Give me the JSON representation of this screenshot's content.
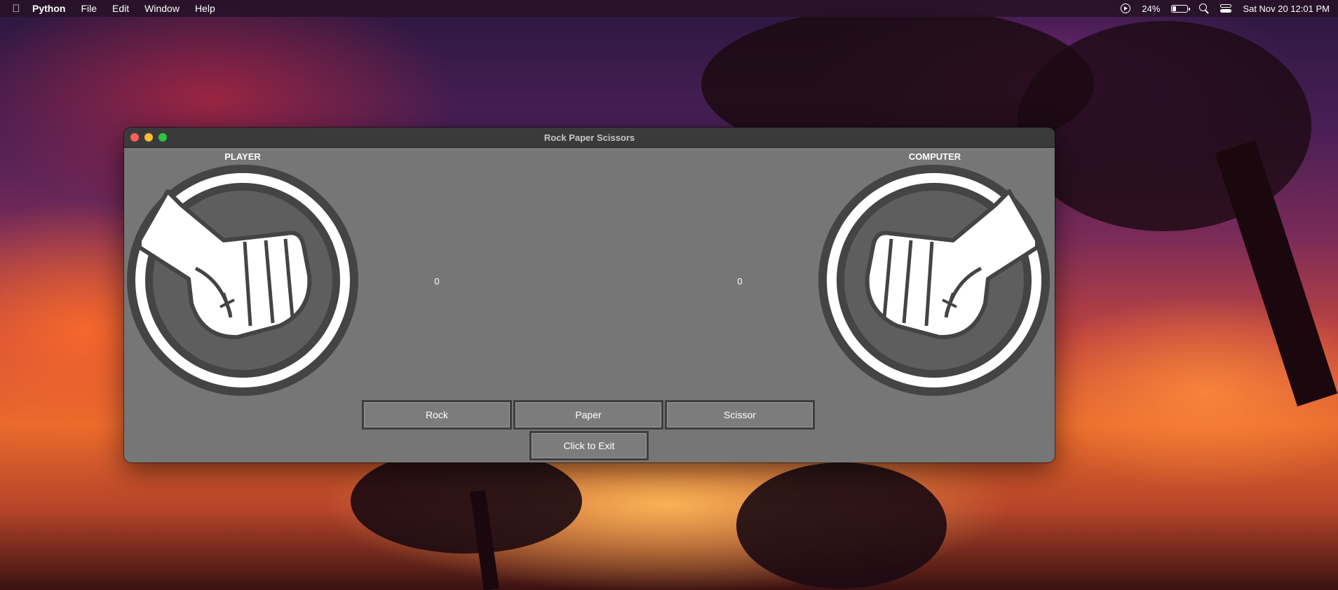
{
  "menubar": {
    "app_name": "Python",
    "items": [
      "File",
      "Edit",
      "Window",
      "Help"
    ],
    "battery_percent": "24%",
    "battery_level": 0.24,
    "datetime": "Sat Nov 20  12:01 PM"
  },
  "window": {
    "title": "Rock Paper Scissors"
  },
  "game": {
    "player_label": "PLAYER",
    "computer_label": "COMPUTER",
    "player_score": "0",
    "computer_score": "0",
    "player_choice": "rock-hand-icon",
    "computer_choice": "rock-hand-icon"
  },
  "buttons": {
    "rock": "Rock",
    "paper": "Paper",
    "scissor": "Scissor",
    "exit": "Click to Exit"
  }
}
